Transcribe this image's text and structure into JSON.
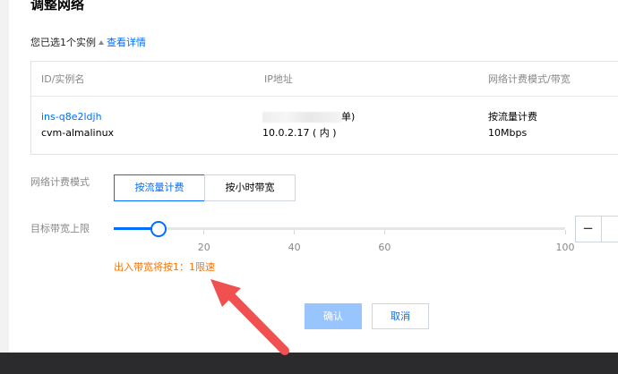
{
  "dialog": {
    "title": "调整网络",
    "selected_text": "您已选1个实例",
    "details_link": "查看详情"
  },
  "table": {
    "headers": [
      "ID/实例名",
      "IP地址",
      "网络计费模式/带宽"
    ],
    "row": {
      "id": "ins-q8e2ldjh",
      "name": "cvm-almalinux",
      "public_ip_suffix": "单)",
      "private_ip": "10.0.2.17 ( 内 )",
      "billing_mode": "按流量计费",
      "bandwidth": "10Mbps"
    }
  },
  "billing": {
    "label": "网络计费模式",
    "options": [
      "按流量计费",
      "按小时带宽"
    ],
    "selected": "按流量计费"
  },
  "bandwidth": {
    "label": "目标带宽上限",
    "min": 0,
    "max": 100,
    "value": 10,
    "ticks": [
      20,
      40,
      60,
      100
    ],
    "minus_label": "−"
  },
  "warning": "出入带宽将按1：1限速",
  "footer": {
    "confirm_label": "确认",
    "cancel_label": "取消"
  },
  "colors": {
    "primary": "#006eff",
    "warning": "#ff7200",
    "annotation_arrow": "#f0504f"
  }
}
